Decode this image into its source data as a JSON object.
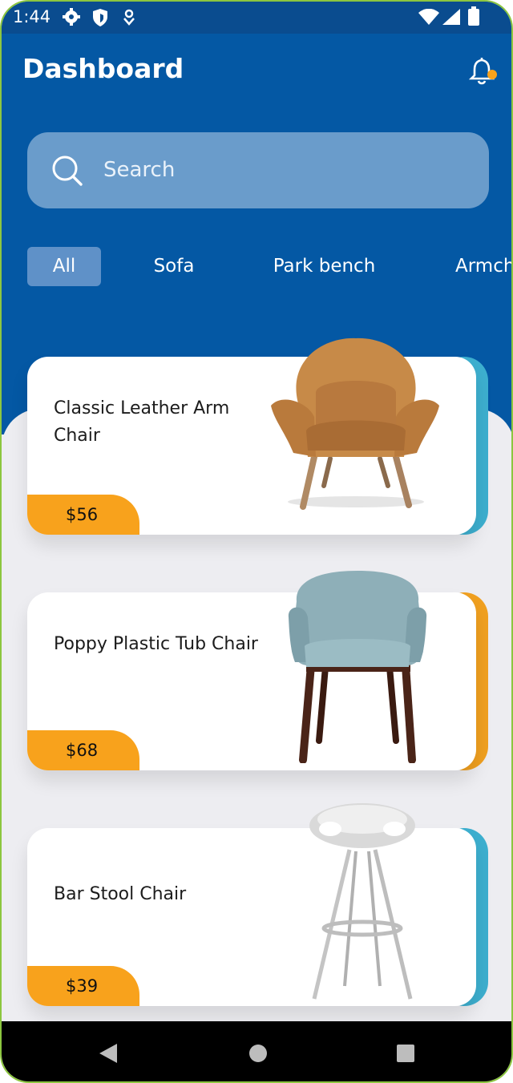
{
  "status_bar": {
    "time": "1:44"
  },
  "header": {
    "title": "Dashboard"
  },
  "search": {
    "placeholder": "Search"
  },
  "categories": [
    "All",
    "Sofa",
    "Park bench",
    "Armch"
  ],
  "products": [
    {
      "name": "Classic Leather Arm Chair",
      "price": "$56",
      "accent": "#3DAFCF"
    },
    {
      "name": "Poppy Plastic Tub Chair",
      "price": "$68",
      "accent": "#F0A020"
    },
    {
      "name": "Bar Stool Chair",
      "price": "$39",
      "accent": "#3DAFCF"
    }
  ],
  "colors": {
    "primary": "#0458A4",
    "price_tag": "#F8A21C",
    "notify_dot": "#F8A21C"
  },
  "icons": [
    "settings-icon",
    "shield-icon",
    "location-icon",
    "wifi-icon",
    "signal-icon",
    "battery-icon",
    "bell-icon",
    "search-icon",
    "back-icon",
    "home-icon",
    "recents-icon"
  ]
}
